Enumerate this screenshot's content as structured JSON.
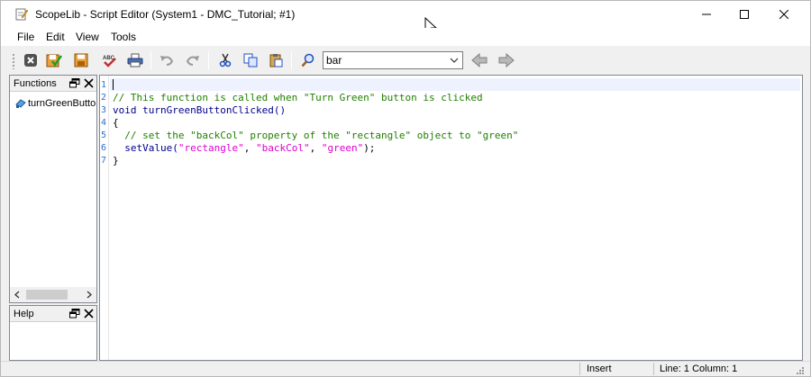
{
  "window": {
    "title": "ScopeLib - Script Editor (System1 - DMC_Tutorial; #1)"
  },
  "menu": {
    "file": "File",
    "edit": "Edit",
    "view": "View",
    "tools": "Tools"
  },
  "toolbar": {
    "search_value": "bar"
  },
  "functions_panel": {
    "title": "Functions",
    "items": [
      "turnGreenButtonClicked"
    ]
  },
  "help_panel": {
    "title": "Help"
  },
  "editor": {
    "line_numbers": [
      "1",
      "2",
      "3",
      "4",
      "5",
      "6",
      "7"
    ],
    "lines": {
      "l2": "// This function is called when \"Turn Green\" button is clicked",
      "l3_kw": "void",
      "l3_fn": " turnGreenButtonClicked()",
      "l4": "{",
      "l5": "  // set the \"backCol\" property of the \"rectangle\" object to \"green\"",
      "l6_fn": "  setValue(",
      "l6_s1": "\"rectangle\"",
      "l6_c1": ", ",
      "l6_s2": "\"backCol\"",
      "l6_c2": ", ",
      "l6_s3": "\"green\"",
      "l6_end": ");",
      "l7": "}"
    }
  },
  "status": {
    "mode": "Insert",
    "position": "Line: 1 Column: 1"
  },
  "colors": {
    "comment": "#208000",
    "keyword": "#00008b",
    "string": "#e000d0",
    "line_number": "#2f6fd1"
  }
}
